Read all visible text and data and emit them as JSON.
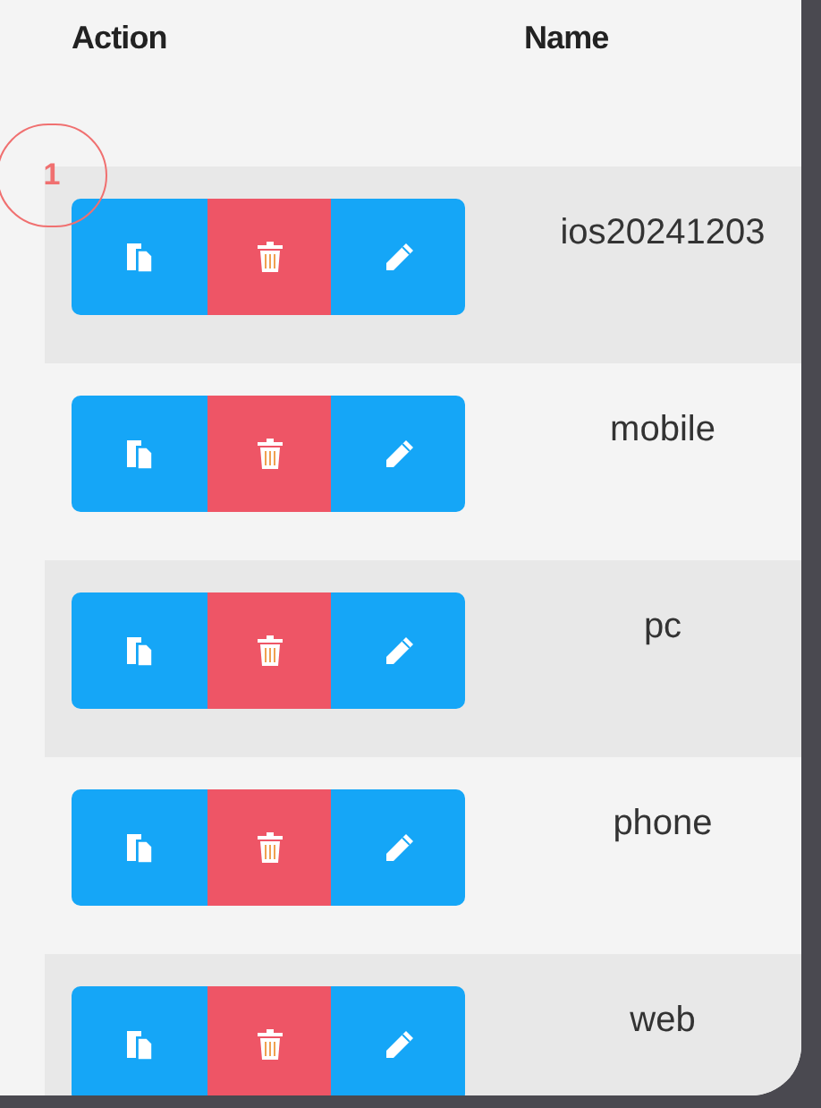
{
  "table": {
    "columns": [
      "Action",
      "Name"
    ],
    "rows": [
      {
        "name": "ios20241203"
      },
      {
        "name": "mobile"
      },
      {
        "name": "pc"
      },
      {
        "name": "phone"
      },
      {
        "name": "web"
      }
    ]
  },
  "annotation": {
    "number": "1"
  }
}
